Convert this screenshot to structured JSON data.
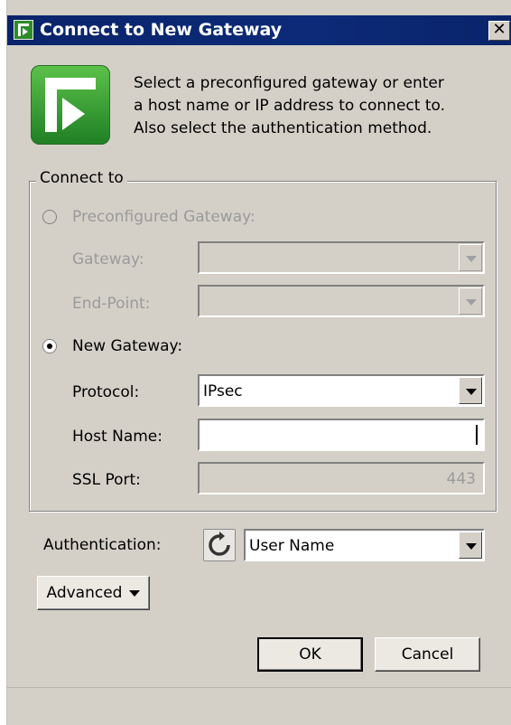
{
  "window": {
    "title": "Connect to New Gateway",
    "close_glyph": "✕",
    "title_icon": "app-logo-icon"
  },
  "intro": {
    "icon": "app-logo-icon",
    "text": "Select a preconfigured gateway or enter\na host name or IP address to connect to.\nAlso select the authentication method."
  },
  "connect_to": {
    "group_label": "Connect to",
    "preconfigured": {
      "label": "Preconfigured Gateway:",
      "selected": false,
      "enabled": false,
      "gateway_label": "Gateway:",
      "gateway_value": "",
      "endpoint_label": "End-Point:",
      "endpoint_value": ""
    },
    "new_gateway": {
      "label": "New Gateway:",
      "selected": true,
      "protocol_label": "Protocol:",
      "protocol_value": "IPsec",
      "host_label": "Host Name:",
      "host_value": "",
      "ssl_label": "SSL Port:",
      "ssl_value": "443"
    }
  },
  "authentication": {
    "label": "Authentication:",
    "value": "User Name",
    "refresh_icon": "refresh-icon"
  },
  "buttons": {
    "advanced": "Advanced",
    "ok": "OK",
    "cancel": "Cancel"
  },
  "colors": {
    "titlebar": "#0a246a",
    "dialog_bg": "#d4d0c8",
    "logo_green": "#3a9a34"
  }
}
